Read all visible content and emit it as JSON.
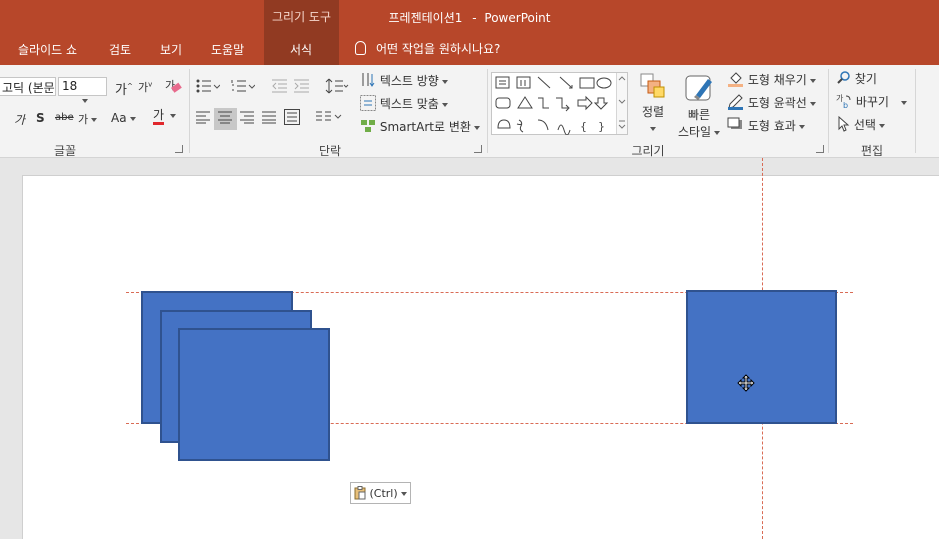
{
  "titlebar": {
    "document_name": "프레젠테이션1",
    "separator": "-",
    "app_name": "PowerPoint",
    "context_group": "그리기 도구",
    "color": "#b7472a"
  },
  "tabs": [
    {
      "label": "슬라이드 쇼"
    },
    {
      "label": "검토"
    },
    {
      "label": "보기"
    },
    {
      "label": "도움말"
    },
    {
      "label": "서식"
    }
  ],
  "tell_me": {
    "label": "어떤 작업을 원하시나요?"
  },
  "ribbon": {
    "font_group": {
      "label": "글꼴",
      "font_name": "고딕 (본문",
      "font_size": "18",
      "increase": "가",
      "decrease": "가",
      "italic": "가",
      "shadow": "S",
      "strike": "abe",
      "spacing": "가",
      "case": "Aa",
      "color_label": "가",
      "font_color": "#e0272c"
    },
    "paragraph_group": {
      "label": "단락",
      "text_direction": "텍스트 방향",
      "align_text": "텍스트 맞춤",
      "smartart": "SmartArt로 변환"
    },
    "drawing_group": {
      "label": "그리기",
      "arrange": "정렬",
      "quick_styles_line1": "빠른",
      "quick_styles_line2": "스타일",
      "shape_fill": "도형 채우기",
      "shape_outline": "도형 윤곽선",
      "shape_effects": "도형 효과"
    },
    "editing_group": {
      "label": "편집",
      "find": "찾기",
      "replace": "바꾸기",
      "select": "선택"
    }
  },
  "slide": {
    "shape_color": "#4472c4",
    "shape_border_color": "#2f528f",
    "guide_color": "#d96b55",
    "paste_options": {
      "label": "(Ctrl)"
    }
  }
}
